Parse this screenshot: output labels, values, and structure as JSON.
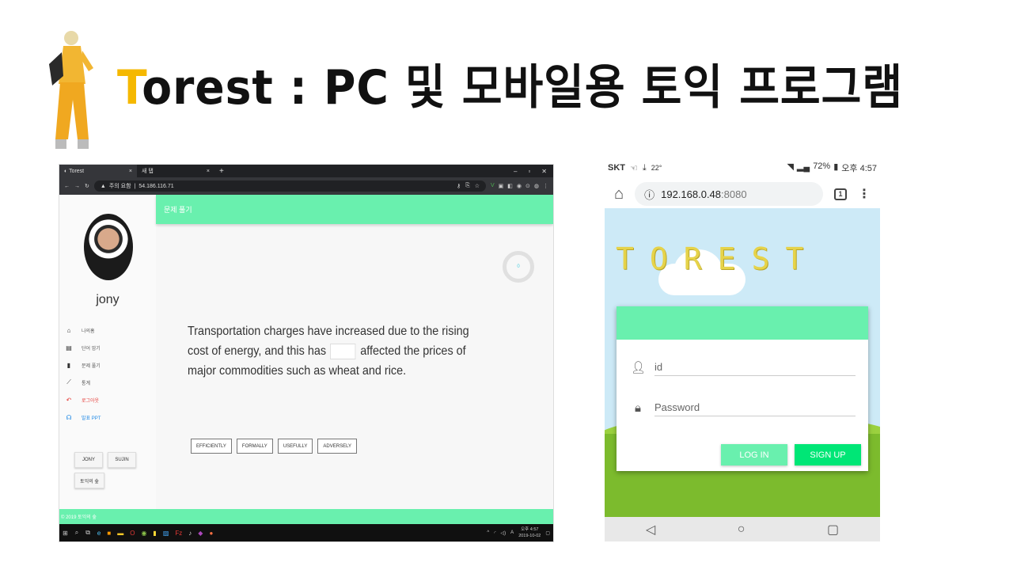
{
  "title": {
    "accent": "T",
    "rest": "orest : PC 및 모바일용 토익 프로그램"
  },
  "pc": {
    "tabs": [
      {
        "label": "Torest"
      },
      {
        "label": "새 탭"
      }
    ],
    "new_tab": "+",
    "url_label": "주의 요함",
    "url": "54.186.116.71",
    "sidebar": {
      "username": "jony",
      "menu": [
        {
          "label": "나의홈"
        },
        {
          "label": "단어 암기"
        },
        {
          "label": "문제 풀기"
        },
        {
          "label": "통계"
        },
        {
          "label": "로그아웃"
        },
        {
          "label": "발표 PPT"
        }
      ],
      "buttons": {
        "jony": "JONY",
        "sujin": "SUJIN",
        "toeic": "토익의 숲"
      }
    },
    "topbar_title": "문제 풀기",
    "timer_value": "0",
    "question": {
      "before": "Transportation charges have increased due to the rising cost of energy, and this has",
      "after": "affected the prices of major commodities such as wheat and rice."
    },
    "choices": [
      "EFFICIENTLY",
      "FORMALLY",
      "USEFULLY",
      "ADVERSELY"
    ],
    "footer": "© 2019 토익의 숲",
    "taskbar": {
      "time": "오후 4:57",
      "date": "2019-10-02",
      "lang": "A"
    }
  },
  "phone": {
    "status": {
      "carrier": "SKT",
      "temp": "22°",
      "battery": "72%",
      "time": "오후 4:57"
    },
    "address": {
      "host": "192.168.0.48",
      "port": ":8080"
    },
    "tab_count": "1",
    "logo": "TOREST",
    "form": {
      "id_placeholder": "id",
      "password_placeholder": "Password",
      "login_label": "LOG IN",
      "signup_label": "SIGN UP"
    }
  }
}
